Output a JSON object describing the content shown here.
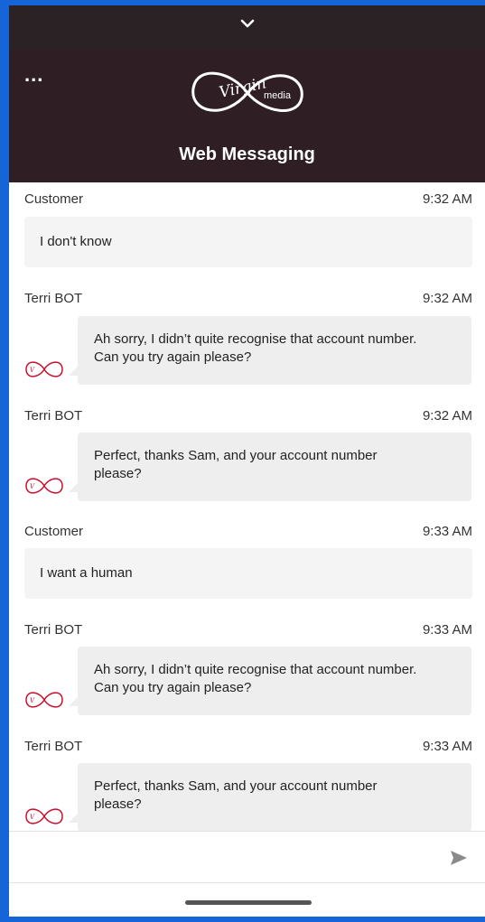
{
  "colors": {
    "header_bg": "#2f1f25",
    "bubble_bg": "#eeeeee",
    "brand_red": "#c8102e",
    "background": "#1565d8"
  },
  "top_bar": {
    "icon": "chevron-down-icon"
  },
  "header": {
    "menu_label": "...",
    "logo_text_virgin": "Virgin",
    "logo_text_media": "media",
    "title": "Web Messaging"
  },
  "messages": [
    {
      "sender": "Customer",
      "time": "9:32 AM",
      "type": "customer",
      "text": "I don't know"
    },
    {
      "sender": "Terri BOT",
      "time": "9:32 AM",
      "type": "bot",
      "text": "Ah sorry, I didn’t quite recognise that account number.\nCan you try again please?"
    },
    {
      "sender": "Terri BOT",
      "time": "9:32 AM",
      "type": "bot",
      "text": "Perfect, thanks Sam, and your account number\nplease?"
    },
    {
      "sender": "Customer",
      "time": "9:33 AM",
      "type": "customer",
      "text": "I want a human"
    },
    {
      "sender": "Terri BOT",
      "time": "9:33 AM",
      "type": "bot",
      "text": "Ah sorry, I didn’t quite recognise that account number.\nCan you try again please?"
    },
    {
      "sender": "Terri BOT",
      "time": "9:33 AM",
      "type": "bot",
      "text": "Perfect, thanks Sam, and your account number\nplease?"
    }
  ],
  "composer": {
    "placeholder": "",
    "send_icon": "send-icon"
  }
}
